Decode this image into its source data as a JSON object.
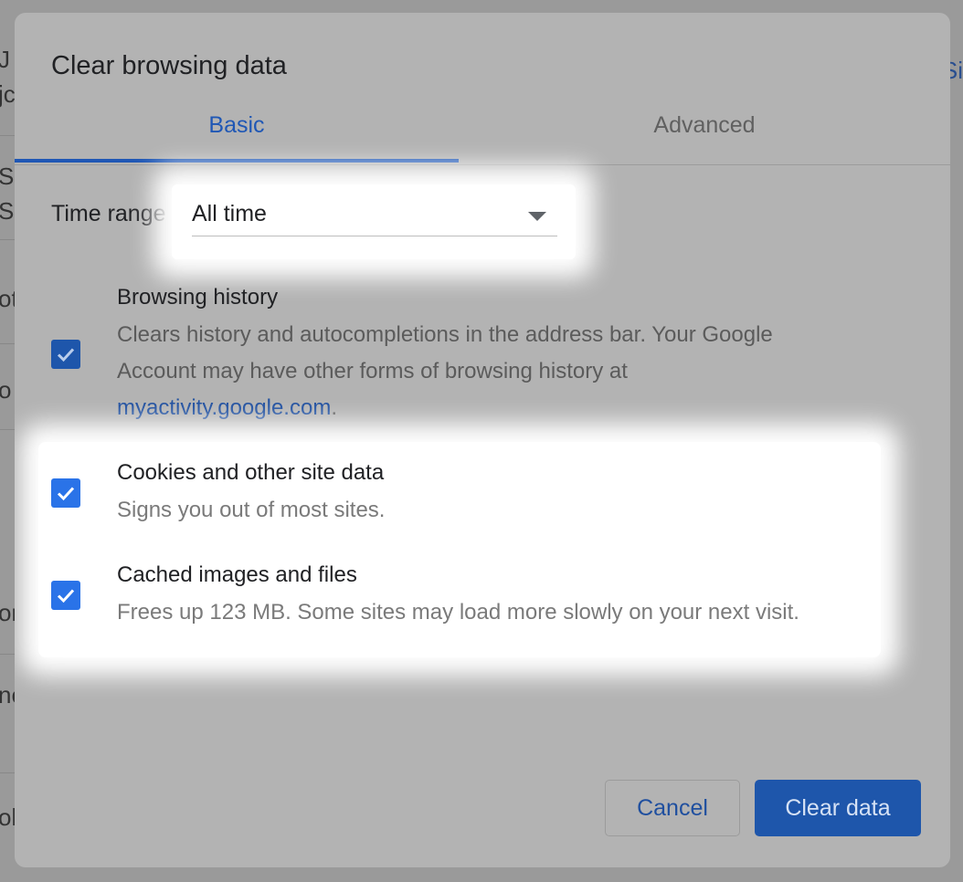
{
  "background": {
    "fragments": [
      "J",
      "jc",
      "S",
      "S",
      "oth",
      "o",
      "or",
      "ne",
      "ok"
    ],
    "right_fragment": "Si"
  },
  "dialog": {
    "title": "Clear browsing data",
    "tabs": [
      {
        "label": "Basic",
        "selected": true
      },
      {
        "label": "Advanced",
        "selected": false
      }
    ],
    "time_range": {
      "label": "Time range",
      "value": "All time"
    },
    "items": [
      {
        "title": "Browsing history",
        "description_line1": "Clears history and autocompletions in the address bar. Your Google",
        "description_line2": "Account may have other forms of browsing history at",
        "link": "myactivity.google.com",
        "link_suffix": ".",
        "checked": true
      },
      {
        "title": "Cookies and other site data",
        "description": "Signs you out of most sites.",
        "checked": true
      },
      {
        "title": "Cached images and files",
        "description": "Frees up 123 MB. Some sites may load more slowly on your next visit.",
        "checked": true
      }
    ],
    "buttons": {
      "cancel": "Cancel",
      "clear": "Clear data"
    }
  },
  "colors": {
    "accent": "#1f57b5",
    "checkbox_highlighted": "#2a73e8",
    "overlay": "#b3b3b3"
  },
  "icons": {
    "checkbox": "checkmark-icon",
    "select": "dropdown-arrow-icon"
  }
}
